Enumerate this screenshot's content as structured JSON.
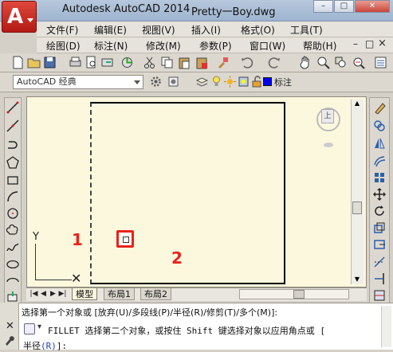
{
  "title_bar": {
    "app_name": "Autodesk AutoCAD 2014",
    "document_name": "Pretty一Boy.dwg",
    "app_button_letter": "A",
    "window_buttons": [
      "–",
      "□",
      "✕"
    ]
  },
  "menu_row1": [
    "文件(F)",
    "编辑(E)",
    "视图(V)",
    "插入(I)",
    "格式(O)",
    "工具(T)"
  ],
  "menu_row2": [
    "绘图(D)",
    "标注(N)",
    "修改(M)",
    "参数(P)",
    "窗口(W)",
    "帮助(H)"
  ],
  "doc_controls": [
    "–",
    "□",
    "×"
  ],
  "workspace": {
    "value": "AutoCAD 经典"
  },
  "layer": {
    "name": "标注"
  },
  "canvas": {
    "ucs_y": "Y",
    "nav_label": "上"
  },
  "annotations": {
    "label1": "1",
    "label2": "2"
  },
  "layout_tabs": {
    "nav": [
      "|◀",
      "◀",
      "▶",
      "▶|"
    ],
    "tabs": [
      "模型",
      "布局1",
      "布局2"
    ]
  },
  "command_line": {
    "line1": "选择第一个对象或 [放弃(U)/多段线(P)/半径(R)/修剪(T)/多个(M)]:",
    "line2": "FILLET 选择第二个对象，或按住 Shift 键选择对象以应用角点或 [",
    "line3_prefix": "半径",
    "line3_option": "(R)",
    "line3_suffix": "]:"
  },
  "colors": {
    "accent_red": "#e8231b",
    "canvas_bg": "#fbf8de",
    "titlebar": "#9eb4cf"
  }
}
